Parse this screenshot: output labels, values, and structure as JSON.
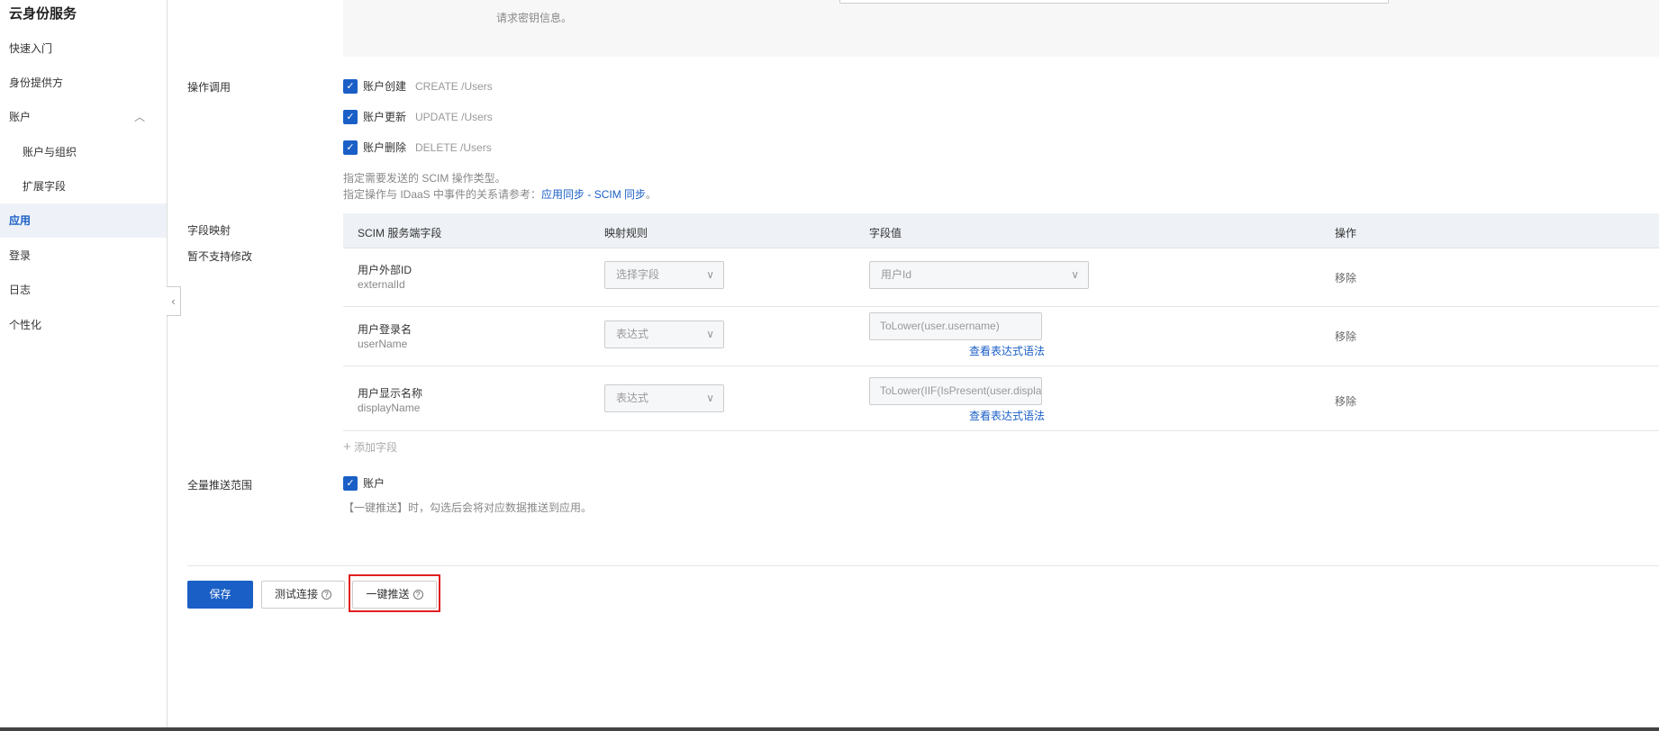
{
  "sidebar": {
    "title": "云身份服务",
    "items": [
      {
        "label": "快速入门"
      },
      {
        "label": "身份提供方"
      },
      {
        "label": "账户"
      },
      {
        "label": "账户与组织"
      },
      {
        "label": "扩展字段"
      },
      {
        "label": "应用"
      },
      {
        "label": "登录"
      },
      {
        "label": "日志"
      },
      {
        "label": "个性化"
      }
    ]
  },
  "secret": {
    "hint": "请求密钥信息。"
  },
  "operations": {
    "label": "操作调用",
    "items": [
      {
        "name": "账户创建",
        "op": "CREATE /Users",
        "checked": true
      },
      {
        "name": "账户更新",
        "op": "UPDATE /Users",
        "checked": true
      },
      {
        "name": "账户删除",
        "op": "DELETE /Users",
        "checked": true
      }
    ],
    "hint1": "指定需要发送的 SCIM 操作类型。",
    "hint2_prefix": "指定操作与 IDaaS 中事件的关系请参考：",
    "hint2_link": "应用同步 - SCIM 同步",
    "hint2_suffix": "。"
  },
  "mapping": {
    "label": "字段映射",
    "sublabel": "暂不支持修改",
    "headers": [
      "SCIM 服务端字段",
      "映射规则",
      "字段值",
      "操作"
    ],
    "rows": [
      {
        "name": "用户外部ID",
        "code": "externalId",
        "rule": "选择字段",
        "value": "用户Id",
        "value_is_select": true,
        "action": "移除"
      },
      {
        "name": "用户登录名",
        "code": "userName",
        "rule": "表达式",
        "value": "ToLower(user.username)",
        "syntax": "查看表达式语法",
        "action": "移除"
      },
      {
        "name": "用户显示名称",
        "code": "displayName",
        "rule": "表达式",
        "value": "ToLower(IIF(IsPresent(user.displayName)",
        "syntax": "查看表达式语法",
        "action": "移除"
      }
    ],
    "add": "添加字段"
  },
  "scope": {
    "label": "全量推送范围",
    "option": "账户",
    "checked": true,
    "hint": "【一键推送】时，勾选后会将对应数据推送到应用。"
  },
  "footer": {
    "save": "保存",
    "test": "测试连接",
    "push": "一键推送"
  }
}
